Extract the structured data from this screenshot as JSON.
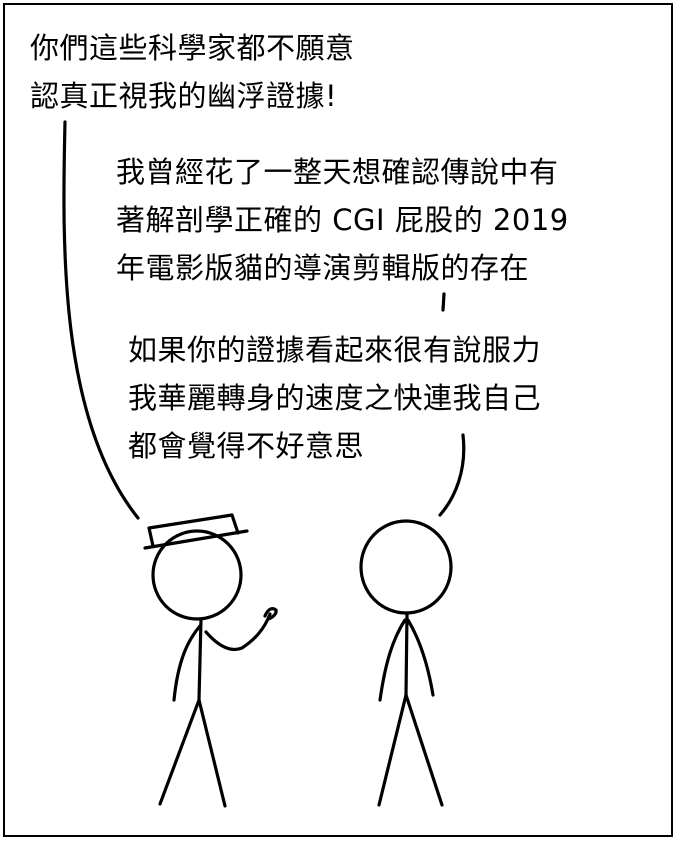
{
  "dialogue": {
    "hat_guy_line": [
      "你們這些科學家都不願意",
      "認真正視我的幽浮證據!"
    ],
    "plain_guy_line": [
      "我曾經花了一整天想確認傳說中有",
      "著解剖學正確的 CGI 屁股的 2019",
      "年電影版貓的導演剪輯版的存在"
    ],
    "plain_guy_second_line": [
      "如果你的證據看起來很有說服力",
      "我華麗轉身的速度之快連我自己",
      "都會覺得不好意思"
    ]
  }
}
